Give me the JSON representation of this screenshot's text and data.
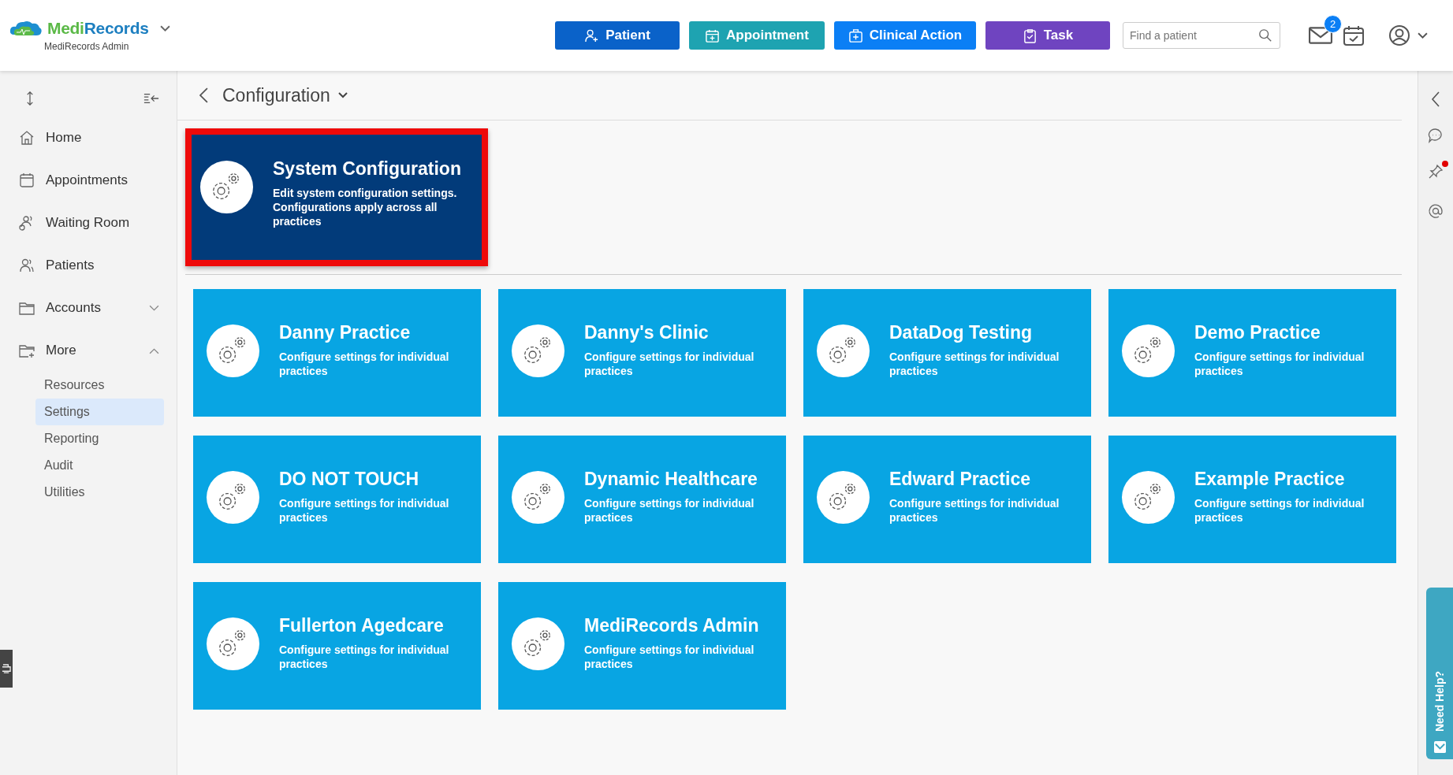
{
  "header": {
    "logo": {
      "first": "Medi",
      "second": "Records"
    },
    "org": "MediRecords Admin",
    "buttons": [
      {
        "label": "Patient",
        "kind": "patient"
      },
      {
        "label": "Appointment",
        "kind": "appointment"
      },
      {
        "label": "Clinical Action",
        "kind": "clinical"
      },
      {
        "label": "Task",
        "kind": "task"
      }
    ],
    "search": {
      "placeholder": "Find a patient"
    },
    "mail_badge": "2"
  },
  "sidebar": {
    "items": [
      {
        "label": "Home",
        "kind": "home"
      },
      {
        "label": "Appointments",
        "kind": "calendar"
      },
      {
        "label": "Waiting Room",
        "kind": "waiting"
      },
      {
        "label": "Patients",
        "kind": "patients"
      },
      {
        "label": "Accounts",
        "kind": "folder",
        "expanded": false
      },
      {
        "label": "More",
        "kind": "folder-plus",
        "expanded": true,
        "children": [
          {
            "label": "Resources",
            "selected": false
          },
          {
            "label": "Settings",
            "selected": true
          },
          {
            "label": "Reporting",
            "selected": false
          },
          {
            "label": "Audit",
            "selected": false
          },
          {
            "label": "Utilities",
            "selected": false
          }
        ]
      }
    ]
  },
  "breadcrumb": {
    "title": "Configuration"
  },
  "system_card": {
    "title": "System Configuration",
    "description": "Edit system configuration settings. Configurations apply across all practices",
    "highlighted": true
  },
  "practice_cards": [
    {
      "title": "Danny Practice",
      "description": "Configure settings for individual practices"
    },
    {
      "title": "Danny's Clinic",
      "description": "Configure settings for individual practices"
    },
    {
      "title": "DataDog Testing",
      "description": "Configure settings for individual practices"
    },
    {
      "title": "Demo Practice",
      "description": "Configure settings for individual practices"
    },
    {
      "title": "DO NOT TOUCH",
      "description": "Configure settings for individual practices"
    },
    {
      "title": "Dynamic Healthcare",
      "description": "Configure settings for individual practices"
    },
    {
      "title": "Edward Practice",
      "description": "Configure settings for individual practices"
    },
    {
      "title": "Example Practice",
      "description": "Configure settings for individual practices"
    },
    {
      "title": "Fullerton Agedcare",
      "description": "Configure settings for individual practices"
    },
    {
      "title": "MediRecords Admin",
      "description": "Configure settings for individual practices"
    }
  ],
  "right_rail": {
    "pin_notification": true
  },
  "help_tab": {
    "label": "Need Help?"
  }
}
